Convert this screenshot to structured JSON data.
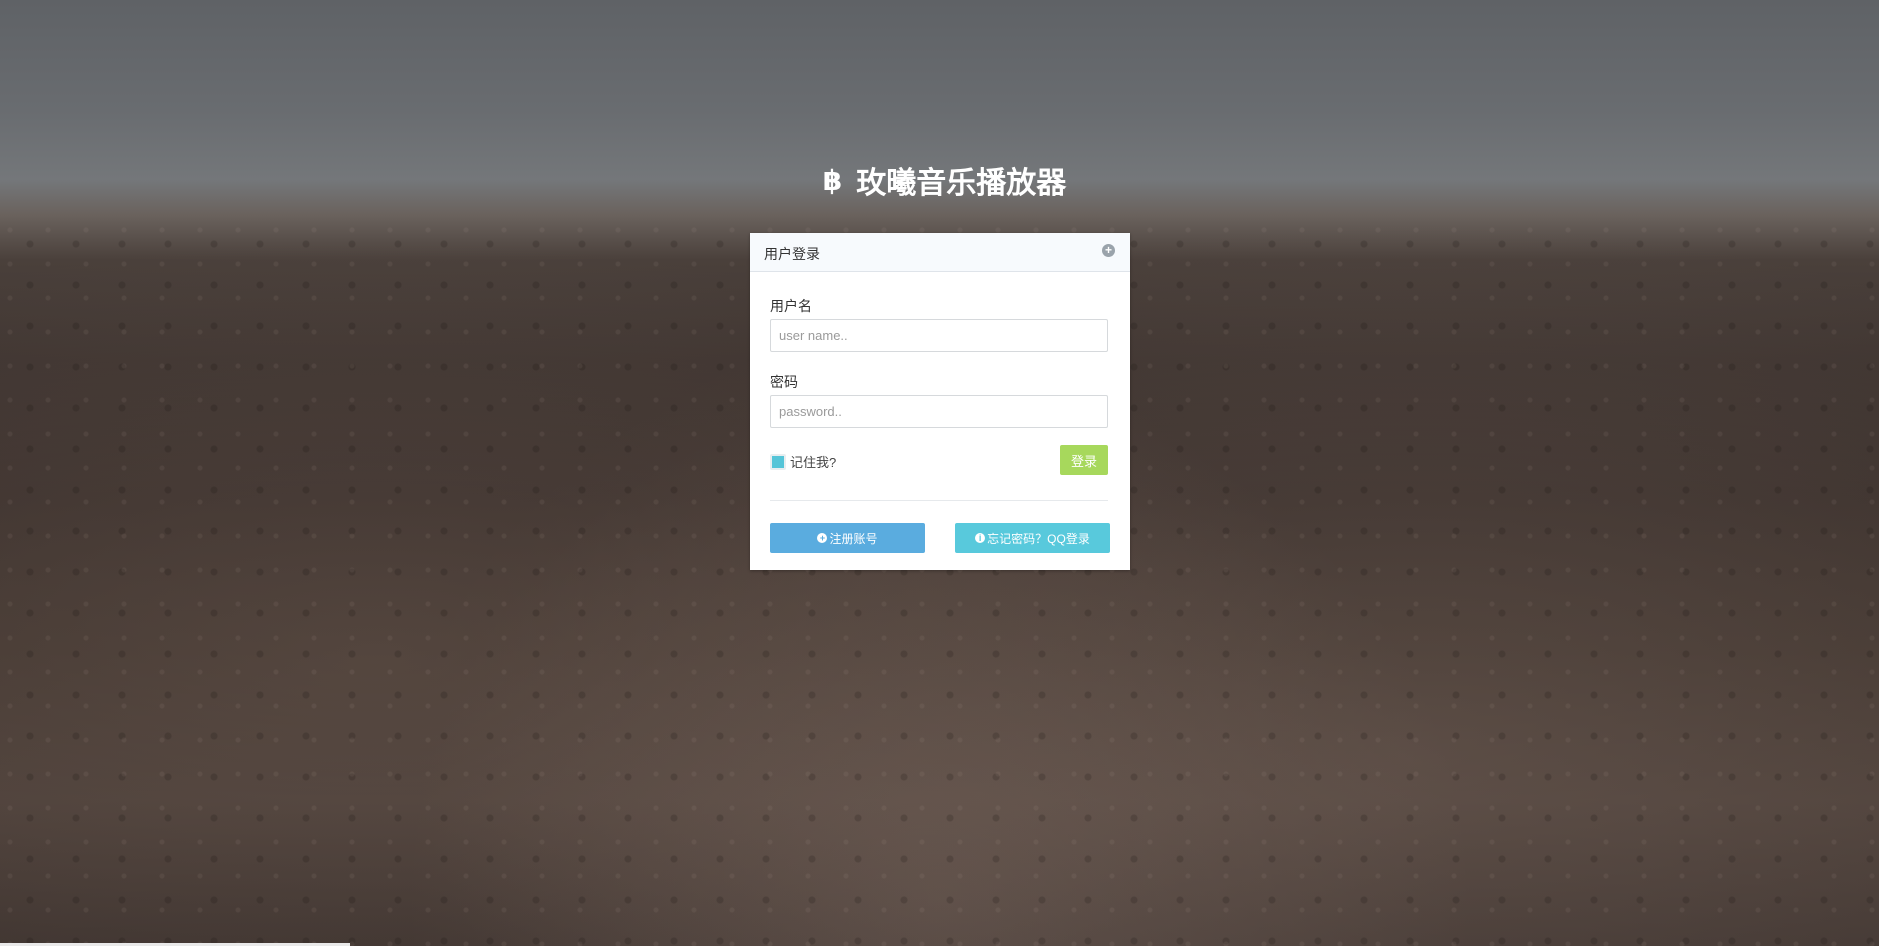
{
  "brand": {
    "icon": "bitcoin-icon",
    "icon_glyph": "฿",
    "title": "玫曦音乐播放器"
  },
  "login_panel": {
    "title": "用户登录",
    "header_icon": "plus-circle-icon",
    "username": {
      "label": "用户名",
      "placeholder": "user name..",
      "value": ""
    },
    "password": {
      "label": "密码",
      "placeholder": "password..",
      "value": ""
    },
    "remember_label": "记住我?",
    "remember_checked": true,
    "login_label": "登录",
    "register_label": "注册账号",
    "register_icon": "plus-circle-icon",
    "forgot_label": "忘记密码？QQ登录",
    "forgot_icon": "info-circle-icon"
  },
  "colors": {
    "login_button": "#a7d85c",
    "register_button": "#5aacdf",
    "forgot_button": "#58c9dc",
    "checkbox": "#55c5d8"
  }
}
